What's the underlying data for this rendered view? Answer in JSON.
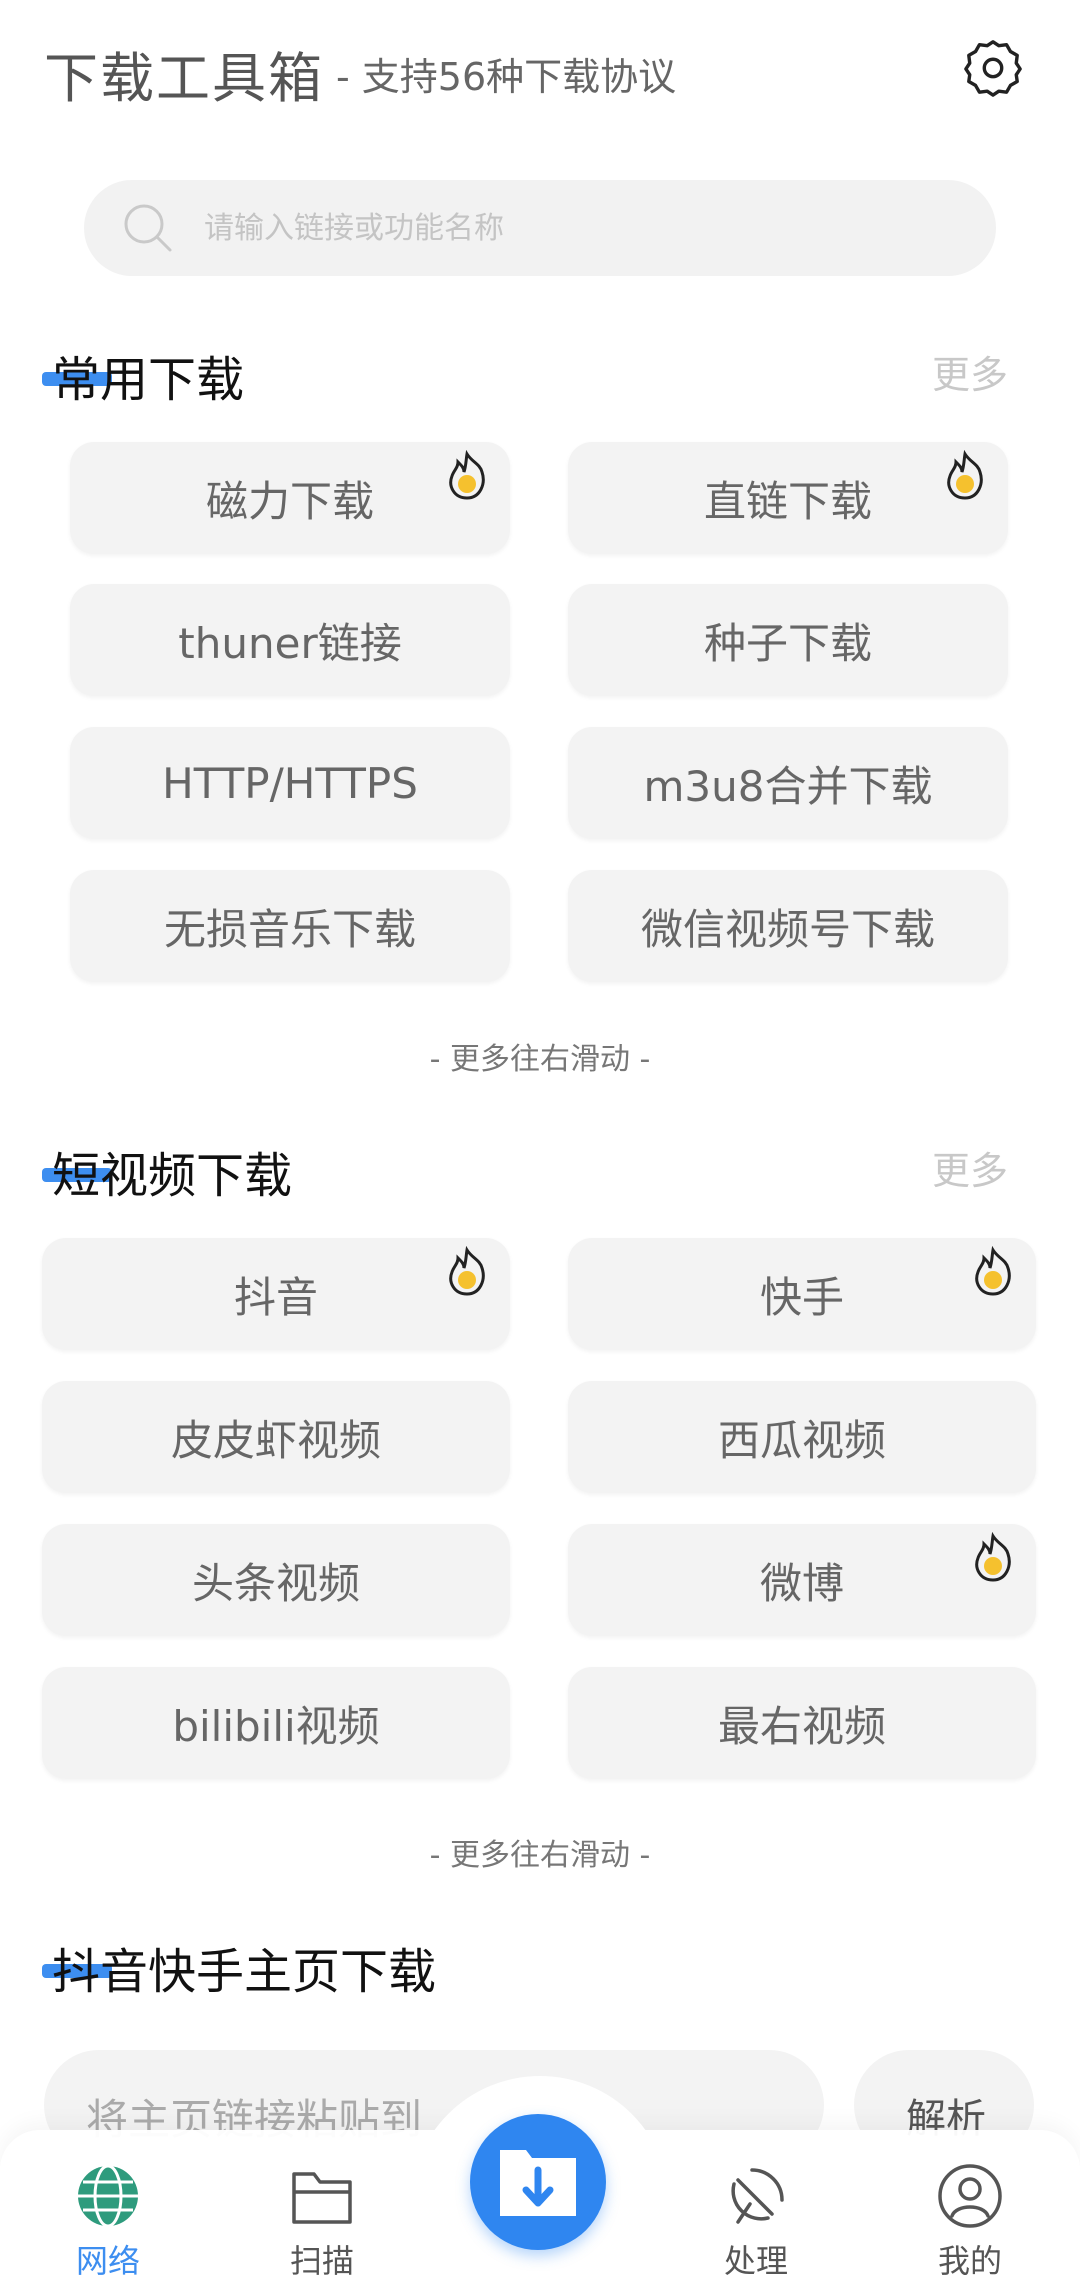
{
  "header": {
    "title": "下载工具箱",
    "subtitle": "- 支持56种下载协议",
    "settings_icon": "settings-icon"
  },
  "search": {
    "placeholder": "请输入链接或功能名称"
  },
  "sections": [
    {
      "title": "常用下载",
      "more": "更多",
      "items": [
        {
          "label": "磁力下载",
          "hot": true
        },
        {
          "label": "直链下载",
          "hot": true
        },
        {
          "label": "thuner链接",
          "hot": false
        },
        {
          "label": "种子下载",
          "hot": false
        },
        {
          "label": "HTTP/HTTPS",
          "hot": false
        },
        {
          "label": "m3u8合并下载",
          "hot": false
        },
        {
          "label": "无损音乐下载",
          "hot": false
        },
        {
          "label": "微信视频号下载",
          "hot": false
        }
      ],
      "scroll_hint": "- 更多往右滑动 -"
    },
    {
      "title": "短视频下载",
      "more": "更多",
      "items": [
        {
          "label": "抖音",
          "hot": true
        },
        {
          "label": "快手",
          "hot": true
        },
        {
          "label": "皮皮虾视频",
          "hot": false
        },
        {
          "label": "西瓜视频",
          "hot": false
        },
        {
          "label": "头条视频",
          "hot": false
        },
        {
          "label": "微博",
          "hot": true
        },
        {
          "label": "bilibili视频",
          "hot": false
        },
        {
          "label": "最右视频",
          "hot": false
        }
      ],
      "scroll_hint": "- 更多往右滑动 -"
    },
    {
      "title": "抖音快手主页下载",
      "paste_placeholder": "将主页链接粘贴到",
      "parse_label": "解析"
    }
  ],
  "tabbar": {
    "tabs": [
      {
        "label": "网络",
        "icon": "globe-icon",
        "active": true
      },
      {
        "label": "扫描",
        "icon": "folder-icon",
        "active": false
      },
      {
        "label": "处理",
        "icon": "satellite-icon",
        "active": false
      },
      {
        "label": "我的",
        "icon": "user-icon",
        "active": false
      }
    ],
    "center_icon": "download-folder-icon"
  },
  "colors": {
    "accent": "#3d8ef0",
    "hot": "#f5c12e",
    "card": "#f3f3f3"
  }
}
